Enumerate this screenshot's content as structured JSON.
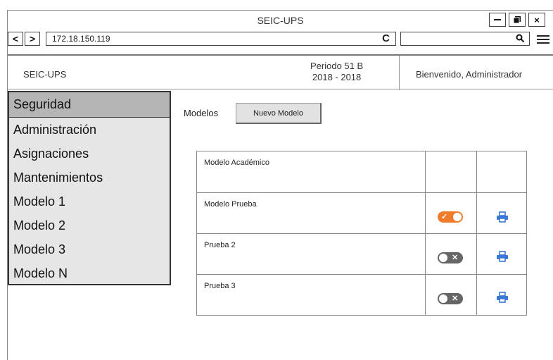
{
  "window": {
    "title": "SEIC-UPS",
    "controls": [
      "minimize-icon",
      "restore-icon",
      "close-icon"
    ],
    "close_glyph": "×"
  },
  "browser": {
    "back_glyph": "<",
    "forward_glyph": ">",
    "url": "172.18.150.119",
    "reload_glyph": "C",
    "search_placeholder": ""
  },
  "header": {
    "brand": "SEIC-UPS",
    "period_line1": "Periodo 51 B",
    "period_line2": "2018 - 2018",
    "welcome": "Bienvenido, Administrador"
  },
  "sidebar": {
    "items": [
      {
        "label": "Seguridad",
        "active": true
      },
      {
        "label": "Administración",
        "active": false
      },
      {
        "label": "Asignaciones",
        "active": false
      },
      {
        "label": "Mantenimientos",
        "active": false
      },
      {
        "label": "Modelo 1",
        "active": false
      },
      {
        "label": "Modelo 2",
        "active": false
      },
      {
        "label": "Modelo 3",
        "active": false
      },
      {
        "label": "Modelo N",
        "active": false
      }
    ]
  },
  "main": {
    "section_label": "Modelos",
    "new_button": "Nuevo Modelo",
    "rows": [
      {
        "name": "Modelo Académico",
        "toggle": null,
        "print": false
      },
      {
        "name": "Modelo Prueba",
        "toggle": "on",
        "print": true
      },
      {
        "name": "Prueba 2",
        "toggle": "off",
        "print": true
      },
      {
        "name": "Prueba 3",
        "toggle": "off",
        "print": true
      }
    ]
  },
  "colors": {
    "toggle_on": "#f07b2b",
    "toggle_off": "#666666",
    "print_icon": "#3a78d8",
    "sidebar_active": "#b5b5b5",
    "sidebar_bg": "#e6e6e6"
  }
}
